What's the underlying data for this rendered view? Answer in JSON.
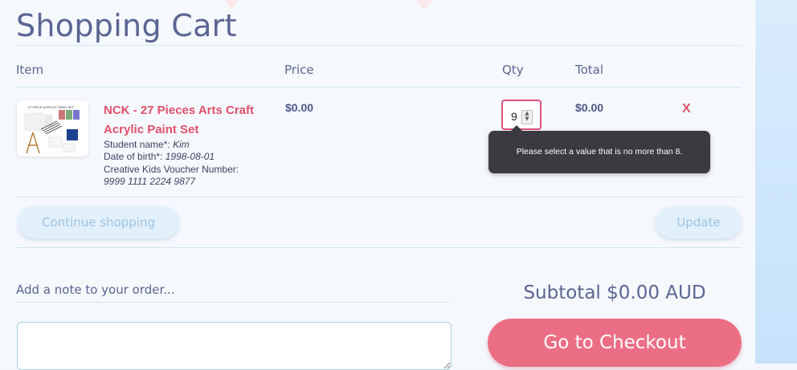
{
  "page_title": "Shopping Cart",
  "table_headers": {
    "item": "Item",
    "price": "Price",
    "qty": "Qty",
    "total": "Total"
  },
  "cart_item": {
    "product_name": "NCK - 27 Pieces Arts Craft Acrylic Paint Set",
    "student_label": "Student name*:",
    "student_value": "Kim",
    "dob_label": "Date of birth*:",
    "dob_value": "1998-08-01",
    "voucher_label": "Creative Kids Voucher Number:",
    "voucher_value": "9999 1111 2224 9877",
    "price": "$0.00",
    "qty": "9",
    "total": "$0.00",
    "remove_label": "X",
    "thumbnail_icon": "paint-set-image"
  },
  "validation_tooltip": "Please select a value that is no more than 8.",
  "buttons": {
    "continue_shopping": "Continue shopping",
    "update": "Update",
    "checkout": "Go to Checkout"
  },
  "note": {
    "label": "Add a note to your order...",
    "placeholder": ""
  },
  "subtotal": "Subtotal $0.00 AUD",
  "colors": {
    "accent_pink": "#e0506b",
    "checkout_button": "#ec6e85",
    "heading_blue": "#5a6593",
    "pill_button": "#e2f0fb"
  }
}
